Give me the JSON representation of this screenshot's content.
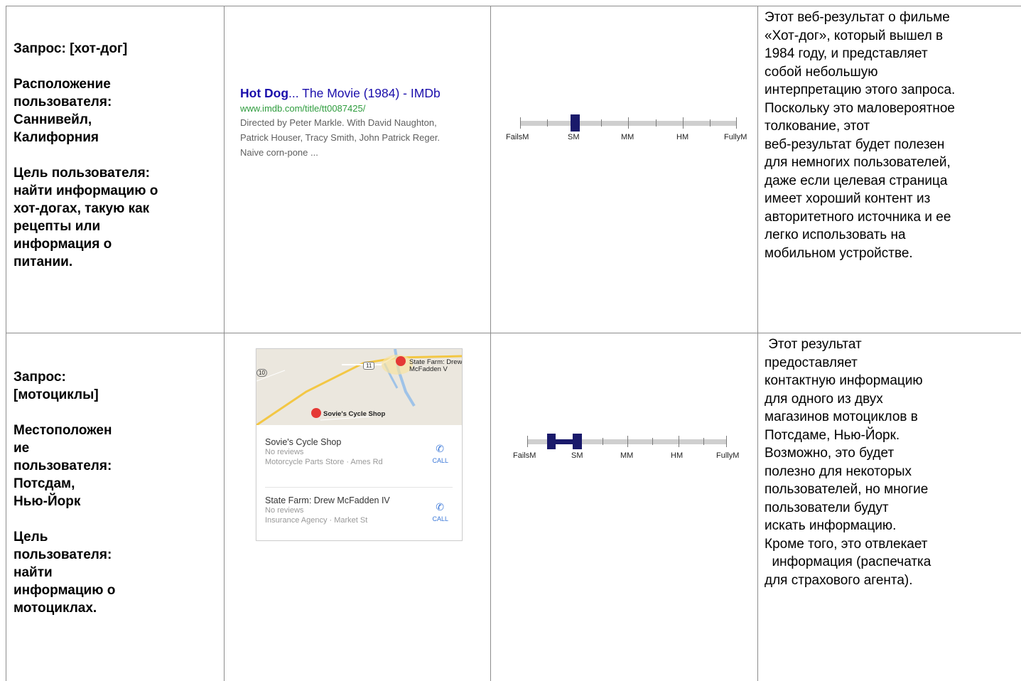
{
  "rows": [
    {
      "query_lines": [
        "Запрос: [хот-дог]",
        "",
        "Расположение",
        "пользователя:",
        "Саннивейл,",
        "Калифорния",
        "",
        "Цель пользователя:",
        "найти информацию о",
        "хот-догах, такую как",
        "рецепты или",
        "информация о",
        "питании."
      ],
      "result": {
        "title_bold": "Hot Dog",
        "title_rest": "... The Movie (1984) - IMDb",
        "url": "www.imdb.com/title/tt0087425/",
        "description": "Directed by Peter Markle. With David Naughton,\nPatrick Houser, Tracy Smith, John Patrick Reger.\nNaive corn-pone ..."
      },
      "rating": {
        "labels": [
          "FailsM",
          "SM",
          "MM",
          "HM",
          "FullyM"
        ],
        "value": "SM",
        "range_from": "SM",
        "range_to": "SM"
      },
      "explanation_lines": [
        "Этот веб-результат о фильме",
        "«Хот-дог», который вышел в",
        "1984 году, и представляет",
        "собой небольшую",
        "интерпретацию этого запроса.",
        "Поскольку это маловероятное",
        "толкование, этот",
        "веб-результат будет полезен",
        "для немногих пользователей,",
        "даже если целевая страница",
        "имеет хороший контент из",
        "авторитетного источника и ее",
        "легко использовать на",
        "мобильном устройстве."
      ]
    },
    {
      "query_lines": [
        "Запрос:",
        "[мотоциклы]",
        "",
        "Местоположен",
        "ие",
        "пользователя:",
        "Потсдам,",
        "Нью-Йорк",
        "",
        "Цель",
        "пользователя:",
        "найти",
        "информацию  о",
        "мотоциклах."
      ],
      "result": {
        "map_labels": {
          "road_left": "10",
          "road_shield": "11",
          "pin_top": "State Farm: Drew McFadden IV",
          "pin_top_line1": "State Farm: Drew",
          "pin_top_line2": "McFadden  V",
          "pin_bottom": "Sovie's Cycle Shop"
        },
        "listings": [
          {
            "name": "Sovie's Cycle Shop",
            "reviews": "No reviews",
            "category": "Motorcycle Parts Store · Ames Rd",
            "action": "CALL"
          },
          {
            "name": "State Farm: Drew McFadden IV",
            "reviews": "No reviews",
            "category": "Insurance Agency · Market St",
            "action": "CALL"
          }
        ]
      },
      "rating": {
        "labels": [
          "FailsM",
          "SM",
          "MM",
          "HM",
          "FullyM"
        ],
        "range_from": "between FailsM and SM",
        "range_to": "SM"
      },
      "explanation_lines": [
        " Этот результат",
        "предоставляет",
        "контактную информацию",
        "для одного из двух",
        "магазинов мотоциклов в",
        "Потсдаме, Нью-Йорк.",
        "Возможно, это будет",
        "полезно для некоторых",
        "пользователей, но многие",
        "пользователи будут",
        "искать информацию.",
        "Кроме того, это отвлекает",
        "  информация (распечатка",
        "для страхового агента)."
      ]
    }
  ],
  "colors": {
    "link": "#1a0dab",
    "url": "#2e9c3d",
    "rating_mark": "#1a1a6b",
    "pin": "#e53935",
    "call": "#3b78d8"
  }
}
